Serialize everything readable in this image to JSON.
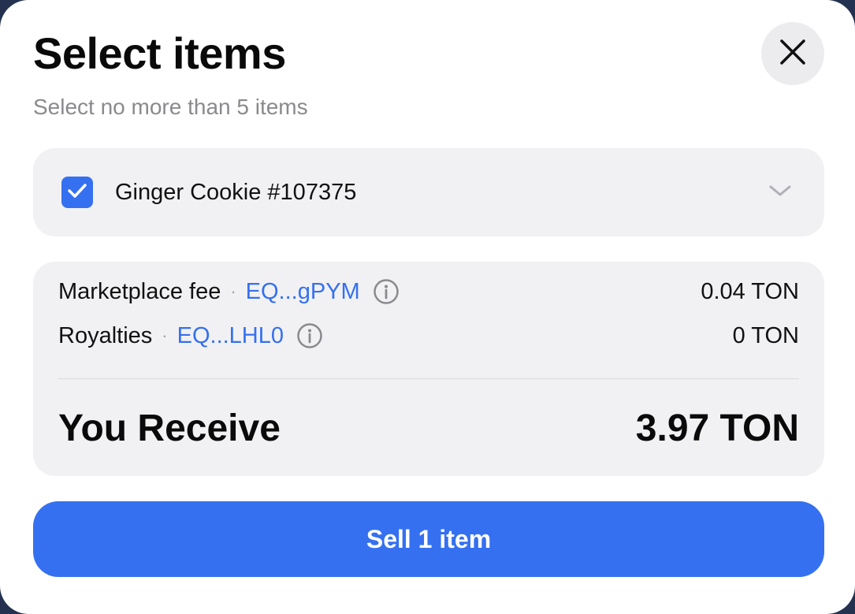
{
  "header": {
    "title": "Select items",
    "subtitle": "Select no more than 5 items"
  },
  "item": {
    "name": "Ginger Cookie #107375",
    "checked": true
  },
  "fees": {
    "marketplace": {
      "label": "Marketplace fee",
      "separator": "·",
      "address": "EQ...gPYM",
      "value": "0.04 TON"
    },
    "royalties": {
      "label": "Royalties",
      "separator": "·",
      "address": "EQ...LHL0",
      "value": "0 TON"
    }
  },
  "receive": {
    "label": "You Receive",
    "value": "3.97 TON"
  },
  "actions": {
    "sell_label": "Sell 1 item"
  },
  "icons": {
    "close": "close-icon",
    "checkbox": "check-icon",
    "expand": "chevron-down-icon",
    "info": "info-icon"
  },
  "colors": {
    "accent": "#3570f0",
    "card_bg": "#f1f1f4",
    "muted_text": "#8a8a8e"
  }
}
